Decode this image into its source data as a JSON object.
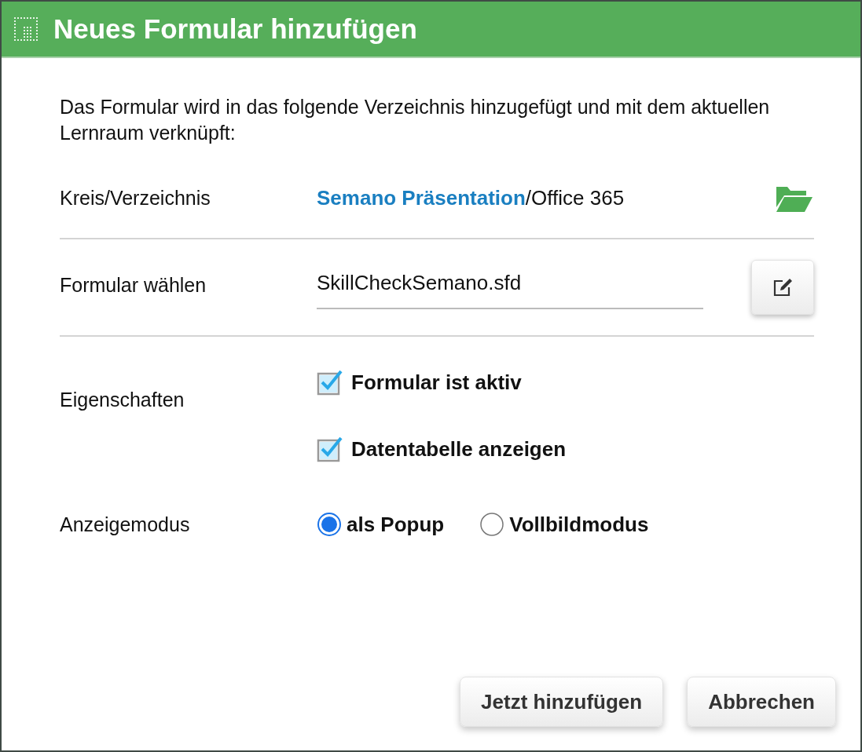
{
  "dialog": {
    "title": "Neues Formular hinzufügen"
  },
  "intro": "Das Formular wird in das folgende Verzeichnis hinzugefügt und mit dem aktuellen Lernraum verknüpft:",
  "directory": {
    "label": "Kreis/Verzeichnis",
    "link": "Semano Präsentation",
    "path": "/Office 365"
  },
  "form_select": {
    "label": "Formular wählen",
    "value": "SkillCheckSemano.sfd"
  },
  "properties": {
    "label": "Eigenschaften",
    "options": [
      {
        "label": "Formular ist aktiv",
        "checked": true
      },
      {
        "label": "Datentabelle anzeigen",
        "checked": true
      }
    ]
  },
  "display_mode": {
    "label": "Anzeigemodus",
    "options": [
      {
        "label": "als Popup",
        "selected": true
      },
      {
        "label": "Vollbildmodus",
        "selected": false
      }
    ]
  },
  "buttons": [
    "Jetzt hinzufügen",
    "Abbrechen"
  ]
}
